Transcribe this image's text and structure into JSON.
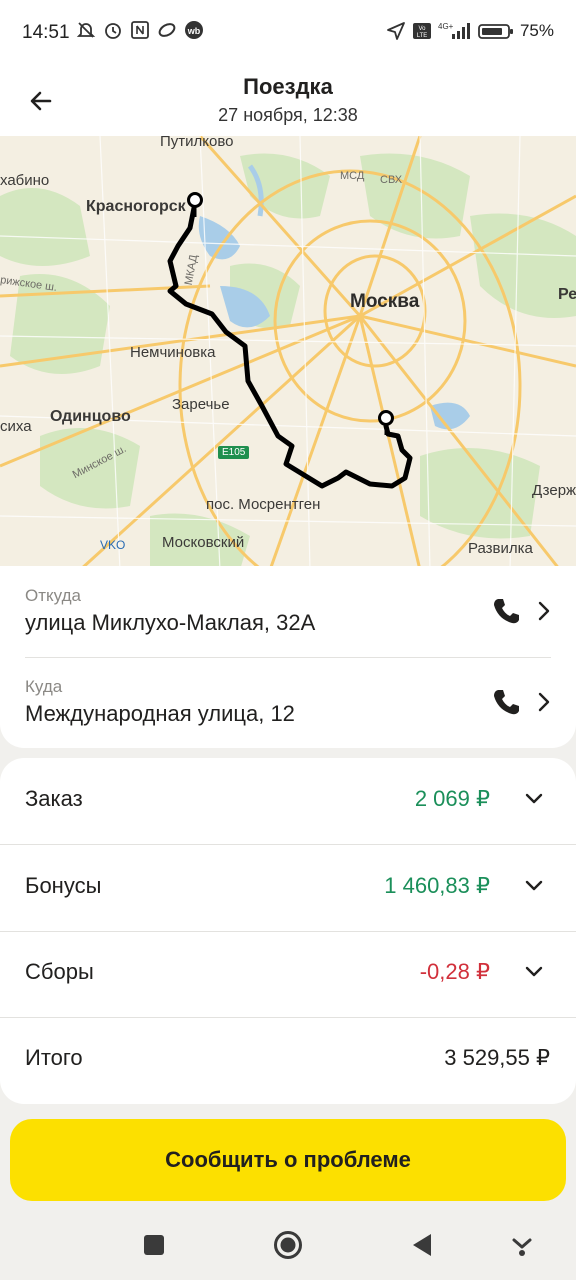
{
  "status_bar": {
    "time": "14:51",
    "network": "4G+",
    "volte": "Vo LTE",
    "battery": "75%",
    "left_icons": [
      "bell-off-icon",
      "alarm-icon",
      "nfc-icon",
      "ozon-icon",
      "wb-icon"
    ],
    "right_icons": [
      "location-icon",
      "volte-icon",
      "signal-icon",
      "battery-icon"
    ]
  },
  "header": {
    "title": "Поездка",
    "subtitle": "27 ноября, 12:38"
  },
  "map": {
    "labels": {
      "putilkovo": "Путилково",
      "krasnogorsk": "Красногорск",
      "khabino": "хабино",
      "moskva": "Москва",
      "nemchinovka": "Немчиновка",
      "zarechye": "Заречье",
      "odintsovo": "Одинцово",
      "sikha": "сиха",
      "mosrentgen": "пос. Мосрентген",
      "moskovsky": "Московский",
      "razvilka": "Развилка",
      "vko": "VKO",
      "dzerzh": "Дзерж",
      "re": "Ре",
      "mkad": "МКАД",
      "msd": "МСД",
      "svkh": "СВХ",
      "minskoe": "Минское ш.",
      "rizhskoe": "рижское ш.",
      "e105": "E105"
    }
  },
  "from": {
    "label": "Откуда",
    "value": "улица Миклухо-Маклая, 32А"
  },
  "to": {
    "label": "Куда",
    "value": "Международная улица, 12"
  },
  "payment": {
    "order_label": "Заказ",
    "order_amount": "2 069 ₽",
    "bonus_label": "Бонусы",
    "bonus_amount": "1 460,83 ₽",
    "fees_label": "Сборы",
    "fees_amount": "-0,28 ₽",
    "total_label": "Итого",
    "total_amount": "3 529,55 ₽"
  },
  "problem_button": "Сообщить о проблеме",
  "colors": {
    "accent": "#fce000",
    "positive": "#1b8f5a",
    "negative": "#d1303b"
  }
}
